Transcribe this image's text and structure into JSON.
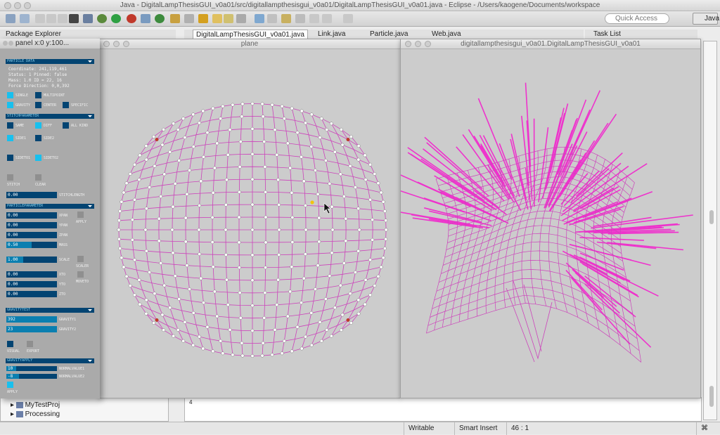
{
  "app": {
    "window_title": "Java - DigitalLampThesisGUI_v0a01/src/digitallampthesisgui_v0a01/DigitalLampThesisGUI_v0a01.java - Eclipse - /Users/kaogene/Documents/workspace",
    "quick_access_placeholder": "Quick Access",
    "perspective_label": "Java"
  },
  "views": {
    "package_explorer_tab": "Package Explorer",
    "task_list_tab": "Task List"
  },
  "editor_tabs": [
    "DigitalLampThesisGUI_v0a01.java",
    "Link.java",
    "Particle.java",
    "Web.java"
  ],
  "package_tree": {
    "items": [
      "MyTestProj",
      "Processing"
    ]
  },
  "console_line": "4",
  "status_bar": {
    "writable": "Writable",
    "insert_mode": "Smart Insert",
    "position": "46 : 1"
  },
  "panel": {
    "title": "panel x:0 y:100...",
    "sections": {
      "particle_data": "PARTICLE DATA",
      "stitch_parameter": "STITCHPARAMETER",
      "particle_parameter": "PARTICLEPARAMETER",
      "gravity_test": "GRAVITYTEST",
      "gravity_apply": "GRAVITYAPPLY"
    },
    "info_lines": [
      "Coordinate: 241,119,461",
      "Status: 1   Pinned: false",
      "Mass: 1.0   ID = 22, 16",
      "Force Direction: 0,0,392"
    ],
    "toggles": {
      "single": "SINGLE",
      "multipoint": "MULTIPOINT",
      "gravity": "GRAVITY",
      "center": "CENTER",
      "specific": "SPECIFIC",
      "same": "SAME",
      "diff": "DIFF",
      "all_kind": "ALL KIND",
      "side1": "SIDE1",
      "side2": "SIDE2",
      "sideto1": "SIDETO1",
      "sideto2": "SIDETO2",
      "stitch": "STITCH",
      "clear": "CLEAR",
      "apply": "APPLY",
      "scaler": "SCALER",
      "moveto": "MOVETO",
      "visual": "VISUAL",
      "export": "EXPORT"
    },
    "sliders": {
      "stitchlength": {
        "label": "STITCHLENGTH",
        "value": "0.00",
        "fill": 0
      },
      "xpan": {
        "label": "XPAN",
        "value": "0.00",
        "fill": 0
      },
      "ypan": {
        "label": "YPAN",
        "value": "0.00",
        "fill": 0
      },
      "zpan": {
        "label": "ZPAN",
        "value": "0.00",
        "fill": 0
      },
      "mass": {
        "label": "MASS",
        "value": "0.50",
        "fill": 0.5
      },
      "scale": {
        "label": "SCALE",
        "value": "1.00",
        "fill": 0.33
      },
      "xto": {
        "label": "XTO",
        "value": "0.00",
        "fill": 0
      },
      "yto": {
        "label": "YTO",
        "value": "0.00",
        "fill": 0
      },
      "zto": {
        "label": "ZTO",
        "value": "0.00",
        "fill": 0
      },
      "gravity1": {
        "label": "GRAVITY1",
        "value": "392",
        "fill": 1
      },
      "gravity2": {
        "label": "GRAVITY2",
        "value": "23",
        "fill": 1
      },
      "normalvalue1": {
        "label": "NORMALVALUE1",
        "value": "10",
        "fill": 0.2
      },
      "normalvalue2": {
        "label": "NORMALVALUE2",
        "value": "-8",
        "fill": 0.25
      }
    },
    "apply_label": "APPLY"
  },
  "plane_window": {
    "title": "plane"
  },
  "view3d_window": {
    "title": "digitallampthesisgui_v0a01.DigitalLampThesisGUI_v0a01"
  },
  "colors": {
    "mesh": "#cc44bb",
    "spikes": "#ee33cc",
    "control_bg": "#034472",
    "control_active": "#18c0ee",
    "panel_bg": "#aaaaaa",
    "canvas_bg": "#cccccc"
  }
}
